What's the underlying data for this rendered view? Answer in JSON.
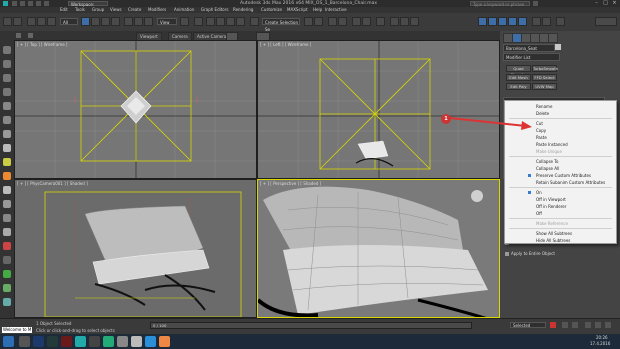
{
  "app": {
    "title": "Autodesk 3ds Max 2016 x64    MIX_OS_1_Barcelona_Chair.max",
    "workspace": "Workspace: Default",
    "search_placeholder": "Type a keyword or phrase"
  },
  "menus": [
    "Edit",
    "Tools",
    "Group",
    "Views",
    "Create",
    "Modifiers",
    "Animation",
    "Graph Editors",
    "Rendering",
    "Customize",
    "MAXScript",
    "Help",
    "Interactive"
  ],
  "toolbar": {
    "filter": "All",
    "view": "View",
    "selection_set": "Create Selection Se"
  },
  "ribbon": {
    "buttons": [
      "Viewport",
      "Camera",
      "Active Camera"
    ]
  },
  "viewports": {
    "top_label": "[ + ] [ Top ] [ Wireframe ]",
    "left_label": "[ + ] [ Left ] [ Wireframe ]",
    "camera_label": "[ + ] [ PhysCamera001 ] [ Shaded ]",
    "persp_label": "[ + ] [ Perspective ] [ Shaded ]"
  },
  "command_panel": {
    "object_name": "Barcelona_Seat",
    "modifier_list": "Modifier List",
    "buttons": [
      "Quad Chamfer",
      "TurboSmooth",
      "Edit Mesh",
      "FFD Select",
      "Edit Poly",
      "UVW Map"
    ],
    "stack_items": [
      "Vertex Color Channel",
      "Apply to Entire Object"
    ]
  },
  "context_menu": {
    "items": [
      {
        "label": "Rename",
        "disabled": false,
        "checked": false
      },
      {
        "label": "Delete",
        "disabled": false,
        "checked": false
      },
      {
        "sep": true
      },
      {
        "label": "Cut",
        "disabled": false,
        "checked": false
      },
      {
        "label": "Copy",
        "disabled": false,
        "checked": false
      },
      {
        "label": "Paste",
        "disabled": false,
        "checked": false
      },
      {
        "label": "Paste Instanced",
        "disabled": false,
        "checked": false
      },
      {
        "label": "Make Unique",
        "disabled": true,
        "checked": false
      },
      {
        "sep": true
      },
      {
        "label": "Collapse To",
        "disabled": false,
        "checked": false
      },
      {
        "label": "Collapse All",
        "disabled": false,
        "checked": false
      },
      {
        "label": "Preserve Custom Attributes",
        "disabled": false,
        "checked": true
      },
      {
        "label": "Retain Subanim Custom Attributes",
        "disabled": false,
        "checked": false
      },
      {
        "sep": true
      },
      {
        "label": "On",
        "disabled": false,
        "checked": true
      },
      {
        "label": "Off in Viewport",
        "disabled": false,
        "checked": false
      },
      {
        "label": "Off in Renderer",
        "disabled": false,
        "checked": false
      },
      {
        "label": "Off",
        "disabled": false,
        "checked": false
      },
      {
        "sep": true
      },
      {
        "label": "Make Reference",
        "disabled": true,
        "checked": false
      },
      {
        "sep": true
      },
      {
        "label": "Show All Subtrees",
        "disabled": false,
        "checked": false
      },
      {
        "label": "Hide All Subtrees",
        "disabled": false,
        "checked": false
      }
    ]
  },
  "callout": {
    "number": "1"
  },
  "status": {
    "welcome": "Welcome to M",
    "selected": "1 Object Selected",
    "prompt": "Click or click-and-drag to select objects",
    "selected_dd": "Selected",
    "frame": "0 / 100"
  },
  "taskbar": {
    "time": "20:26",
    "date": "17.4.2016"
  },
  "colors": {
    "accent_blue": "#3d6ea8",
    "callout_red": "#cc3333",
    "grid_yellow": "#d8d800"
  }
}
